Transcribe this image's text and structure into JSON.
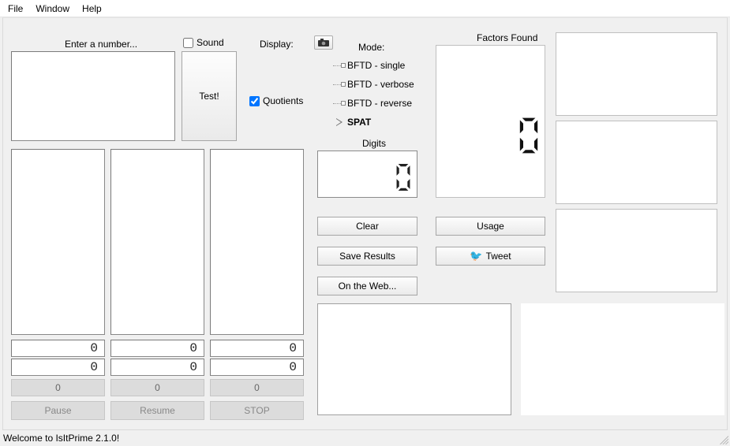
{
  "menu": {
    "file": "File",
    "window": "Window",
    "help": "Help"
  },
  "topRow": {
    "enterNumber": "Enter a number...",
    "sound": "Sound",
    "display": "Display:",
    "soundChecked": false,
    "quotients": "Quotients",
    "quotientsChecked": true,
    "testBtn": "Test!",
    "camera": "camera-icon"
  },
  "modes": {
    "title": "Mode:",
    "items": [
      {
        "label": "BFTD - single",
        "selected": false
      },
      {
        "label": "BFTD - verbose",
        "selected": false
      },
      {
        "label": "BFTD - reverse",
        "selected": false
      },
      {
        "label": "SPAT",
        "selected": true
      }
    ]
  },
  "digits": {
    "label": "Digits",
    "value": "0"
  },
  "factors": {
    "label": "Factors Found",
    "value": "0"
  },
  "buttons": {
    "clear": "Clear",
    "saveResults": "Save Results",
    "onTheWeb": "On the Web...",
    "usage": "Usage",
    "tweet": "Tweet"
  },
  "columns": {
    "seg1a": "0",
    "seg1b": "0",
    "count1": "0",
    "btn1": "Pause",
    "seg2a": "0",
    "seg2b": "0",
    "count2": "0",
    "btn2": "Resume",
    "seg3a": "0",
    "seg3b": "0",
    "count3": "0",
    "btn3": "STOP"
  },
  "status": "Welcome to IsItPrime 2.1.0!"
}
